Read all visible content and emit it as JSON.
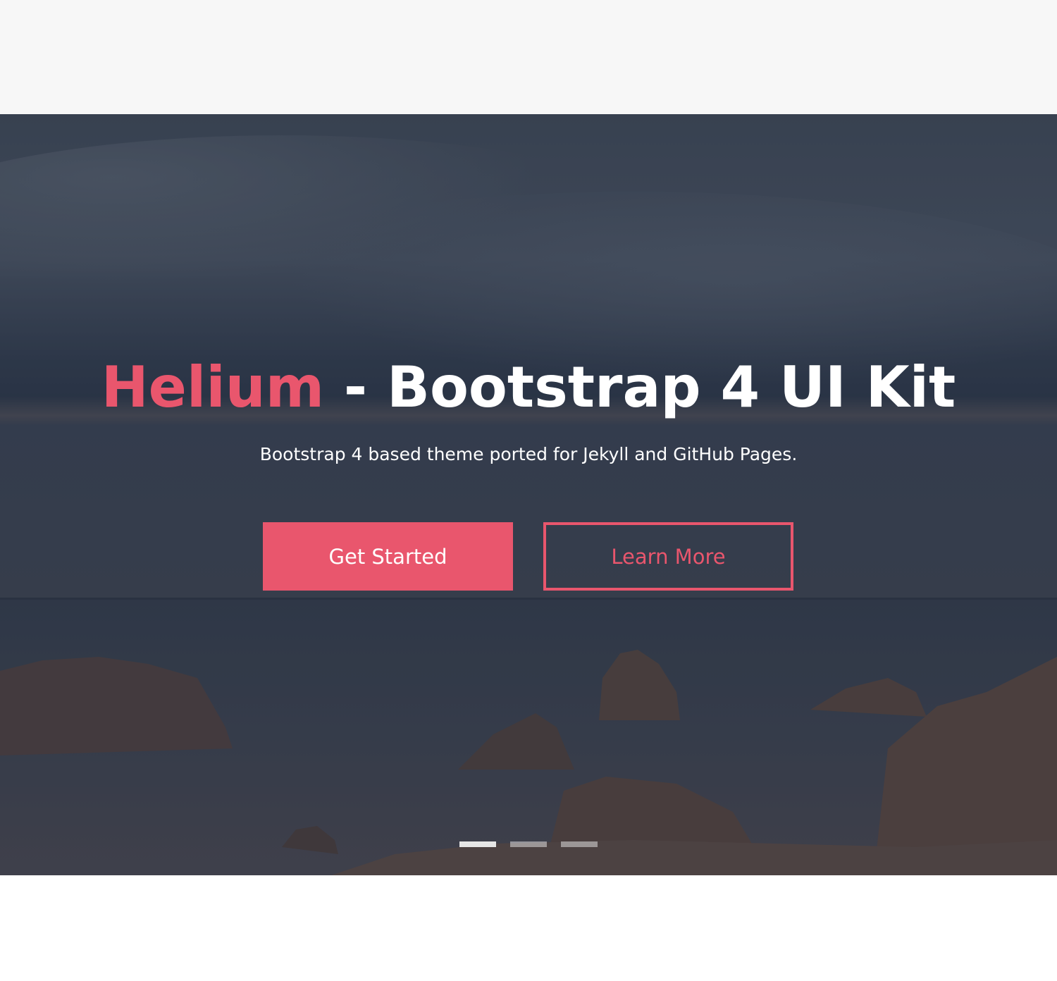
{
  "hero": {
    "title_brand": "Helium",
    "title_rest": " - Bootstrap 4 UI Kit",
    "subtitle": "Bootstrap 4 based theme ported for Jekyll and GitHub Pages.",
    "primary_button_label": "Get Started",
    "secondary_button_label": "Learn More",
    "accent_color": "#e9566d"
  },
  "carousel": {
    "slide_count": 3,
    "active_index": 0
  }
}
